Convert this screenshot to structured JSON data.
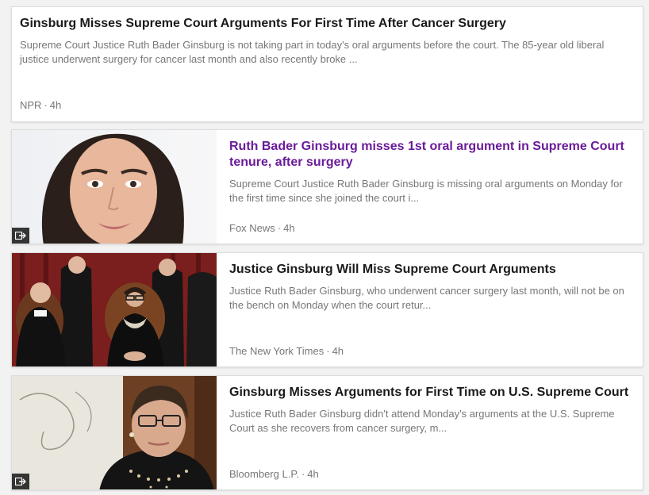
{
  "articles": [
    {
      "title": "Ginsburg Misses Supreme Court Arguments For First Time After Cancer Surgery",
      "snippet": "Supreme Court Justice Ruth Bader Ginsburg is not taking part in today's oral arguments before the court. The 85-year old liberal justice underwent surgery for cancer last month and also recently broke ...",
      "source": "NPR",
      "age": "4h",
      "visited": false,
      "has_image": false
    },
    {
      "title": "Ruth Bader Ginsburg misses 1st oral argument in Supreme Court tenure, after surgery",
      "snippet": "Supreme Court Justice Ruth Bader Ginsburg is missing oral arguments on Monday for the first time since she joined the court i...",
      "source": "Fox News",
      "age": "4h",
      "visited": true,
      "has_image": true,
      "image_icon": "external-link-icon"
    },
    {
      "title": "Justice Ginsburg Will Miss Supreme Court Arguments",
      "snippet": "Justice Ruth Bader Ginsburg, who underwent cancer surgery last month, will not be on the bench on Monday when the court retur...",
      "source": "The New York Times",
      "age": "4h",
      "visited": false,
      "has_image": true
    },
    {
      "title": "Ginsburg Misses Arguments for First Time on U.S. Supreme Court",
      "snippet": "Justice Ruth Bader Ginsburg didn't attend Monday's arguments at the U.S. Supreme Court as she recovers from cancer surgery, m...",
      "source": "Bloomberg L.P.",
      "age": "4h",
      "visited": false,
      "has_image": true,
      "image_icon": "external-link-icon"
    }
  ],
  "colors": {
    "title": "#1a1a1a",
    "visited_title": "#6a1b9a",
    "meta": "#777777",
    "card_bg": "#ffffff",
    "page_bg": "#f2f2f2"
  },
  "separator": "·"
}
